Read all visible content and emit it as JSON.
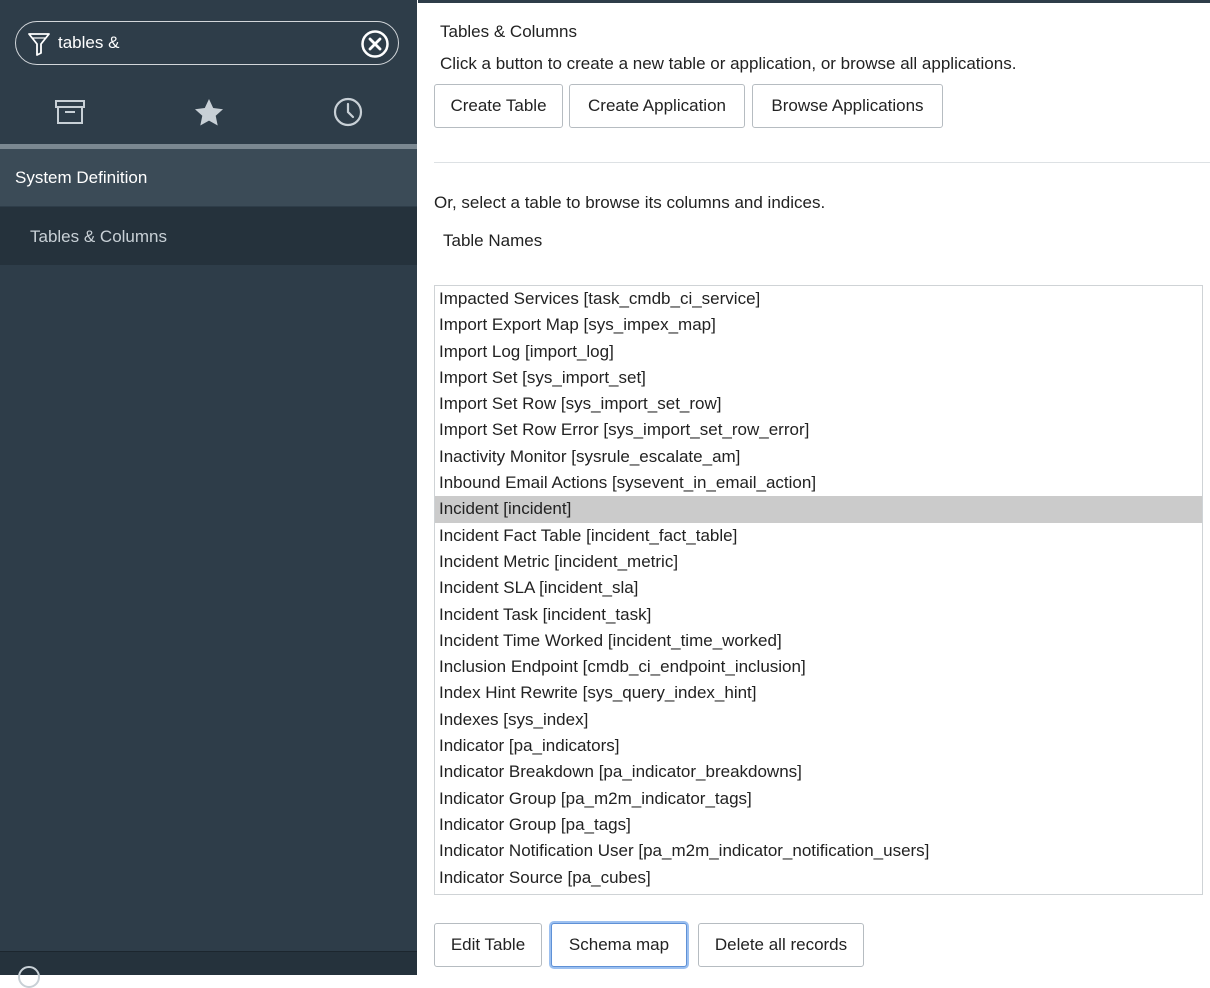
{
  "nav": {
    "filter_value": "tables &",
    "tabs": [
      {
        "icon": "archive-icon",
        "label": "All"
      },
      {
        "icon": "star-icon",
        "label": "Favorites"
      },
      {
        "icon": "clock-icon",
        "label": "History"
      }
    ],
    "application": "System Definition",
    "module": "Tables & Columns"
  },
  "main": {
    "title": "Tables & Columns",
    "description": "Click a button to create a new table or application, or browse all applications.",
    "buttons": {
      "create_table": "Create Table",
      "create_application": "Create Application",
      "browse_applications": "Browse Applications"
    },
    "select_help": "Or, select a table to browse its columns and indices.",
    "list_label": "Table Names",
    "tables": [
      "Impacted Services [task_cmdb_ci_service]",
      "Import Export Map [sys_impex_map]",
      "Import Log [import_log]",
      "Import Set [sys_import_set]",
      "Import Set Row [sys_import_set_row]",
      "Import Set Row Error [sys_import_set_row_error]",
      "Inactivity Monitor [sysrule_escalate_am]",
      "Inbound Email Actions [sysevent_in_email_action]",
      "Incident [incident]",
      "Incident Fact Table [incident_fact_table]",
      "Incident Metric [incident_metric]",
      "Incident SLA [incident_sla]",
      "Incident Task [incident_task]",
      "Incident Time Worked [incident_time_worked]",
      "Inclusion Endpoint [cmdb_ci_endpoint_inclusion]",
      "Index Hint Rewrite [sys_query_index_hint]",
      "Indexes [sys_index]",
      "Indicator [pa_indicators]",
      "Indicator Breakdown [pa_indicator_breakdowns]",
      "Indicator Group [pa_m2m_indicator_tags]",
      "Indicator Group [pa_tags]",
      "Indicator Notification User [pa_m2m_indicator_notification_users]",
      "Indicator Source [pa_cubes]"
    ],
    "selected_table": "Incident [incident]",
    "bottom_buttons": {
      "edit_table": "Edit Table",
      "schema_map": "Schema map",
      "delete_all": "Delete all records"
    }
  },
  "colors": {
    "sidebar_bg": "#2e3d49",
    "sidebar_section_bg": "#3b4b57",
    "sidebar_module_bg": "#25323c",
    "selected_row_bg": "#cbcbcb",
    "focus_ring": "#9cc0f0"
  }
}
